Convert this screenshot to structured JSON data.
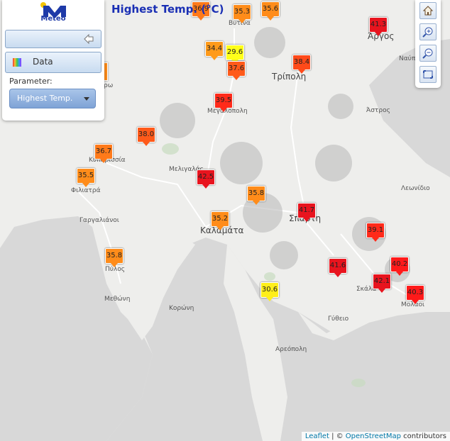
{
  "title": "Highest Temp. (°C)",
  "panel": {
    "logo_text": "Meteo",
    "data_label": "Data",
    "parameter_label": "Parameter:",
    "parameter_value": "Highest Temp.",
    "icons": [
      "back-arrow-icon",
      "data-rainbow-icon",
      "chevron-down-icon"
    ]
  },
  "toolbar": {
    "icons": [
      "home-icon",
      "zoom-in-icon",
      "zoom-out-icon",
      "fullscreen-icon"
    ]
  },
  "attribution": {
    "leaflet": "Leaflet",
    "sep": " | © ",
    "osm": "OpenStreetMap",
    "contributors": " contributors"
  },
  "places": [
    "Βυτινα",
    "Άργος",
    "Ναύπλιο",
    "Τρίπολη",
    "Μεγαλόπολη",
    "Άστρος",
    "Κυπαρισσία",
    "Μελιγαλάς",
    "Λεωνίδιο",
    "Φιλιατρά",
    "Γαργαλιάνοι",
    "Καλαμάτα",
    "Σπάρτη",
    "Πύλος",
    "Σκάλα",
    "Μολάοι",
    "Μεθώνη",
    "Κορώνη",
    "Γύθειο",
    "Αρεόπολη",
    "ρω"
  ],
  "markers": [
    {
      "value": "36.9",
      "color": "#ff7a1a"
    },
    {
      "value": "35.3",
      "color": "#ff8c1a"
    },
    {
      "value": "35.6",
      "color": "#ff8c1a"
    },
    {
      "value": "41.3",
      "color": "#e8141e"
    },
    {
      "value": "34.4",
      "color": "#ff9a1a"
    },
    {
      "value": "29.6",
      "color": "#ffff1a"
    },
    {
      "value": "37.6",
      "color": "#ff5a1a"
    },
    {
      "value": "38.4",
      "color": "#ff4a1a"
    },
    {
      "value": "39.5",
      "color": "#ff2a1a"
    },
    {
      "value": "38.0",
      "color": "#ff5a1a"
    },
    {
      "value": "36.7",
      "color": "#ff7a1a"
    },
    {
      "value": "35.5",
      "color": "#ff8c1a"
    },
    {
      "value": "42.5",
      "color": "#e8141e"
    },
    {
      "value": "35.8",
      "color": "#ff8c1a"
    },
    {
      "value": "41.7",
      "color": "#e8141e"
    },
    {
      "value": "39.1",
      "color": "#ff2a1a"
    },
    {
      "value": "35.2",
      "color": "#ff8c1a"
    },
    {
      "value": "35.8",
      "color": "#ff8c1a"
    },
    {
      "value": "41.6",
      "color": "#e8141e"
    },
    {
      "value": "40.2",
      "color": "#ff1a1a"
    },
    {
      "value": "42.1",
      "color": "#e8141e"
    },
    {
      "value": "40.3",
      "color": "#ff1a1a"
    },
    {
      "value": "30.6",
      "color": "#ffee1a"
    }
  ]
}
